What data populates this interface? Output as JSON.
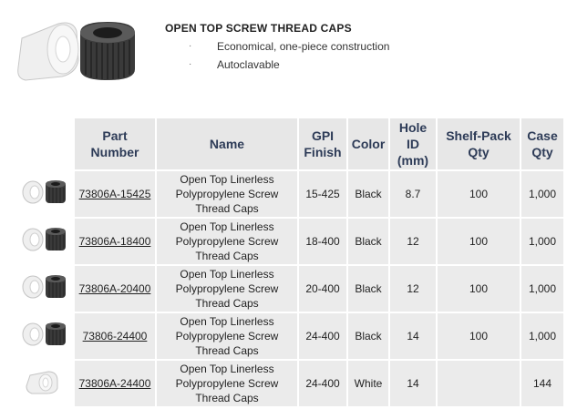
{
  "product": {
    "title": "OPEN TOP SCREW THREAD CAPS",
    "bullets": [
      "Economical, one-piece construction",
      "Autoclavable"
    ]
  },
  "table": {
    "headers": {
      "part_number": "Part Number",
      "name": "Name",
      "gpi_finish": "GPI Finish",
      "color": "Color",
      "hole_id": "Hole ID (mm)",
      "shelf_pack_qty": "Shelf-Pack Qty",
      "case_qty": "Case Qty"
    },
    "rows": [
      {
        "part_number": "73806A-15425",
        "name": "Open Top Linerless Polypropylene Screw Thread Caps",
        "gpi_finish": "15-425",
        "color": "Black",
        "hole_id": "8.7",
        "shelf_pack_qty": "100",
        "case_qty": "1,000",
        "thumb": "white-and-black-caps"
      },
      {
        "part_number": "73806A-18400",
        "name": "Open Top Linerless Polypropylene Screw Thread Caps",
        "gpi_finish": "18-400",
        "color": "Black",
        "hole_id": "12",
        "shelf_pack_qty": "100",
        "case_qty": "1,000",
        "thumb": "white-and-black-caps"
      },
      {
        "part_number": "73806A-20400",
        "name": "Open Top Linerless Polypropylene Screw Thread Caps",
        "gpi_finish": "20-400",
        "color": "Black",
        "hole_id": "12",
        "shelf_pack_qty": "100",
        "case_qty": "1,000",
        "thumb": "white-and-black-caps"
      },
      {
        "part_number": "73806-24400",
        "name": "Open Top Linerless Polypropylene Screw Thread Caps",
        "gpi_finish": "24-400",
        "color": "Black",
        "hole_id": "14",
        "shelf_pack_qty": "100",
        "case_qty": "1,000",
        "thumb": "white-and-black-caps"
      },
      {
        "part_number": "73806A-24400",
        "name": "Open Top Linerless Polypropylene Screw Thread Caps",
        "gpi_finish": "24-400",
        "color": "White",
        "hole_id": "14",
        "shelf_pack_qty": "",
        "case_qty": "144",
        "thumb": "white-cap"
      }
    ]
  },
  "colors": {
    "header_bg": "#e7e7e7",
    "header_text": "#2d3b57",
    "cell_bg": "#ebebeb"
  }
}
